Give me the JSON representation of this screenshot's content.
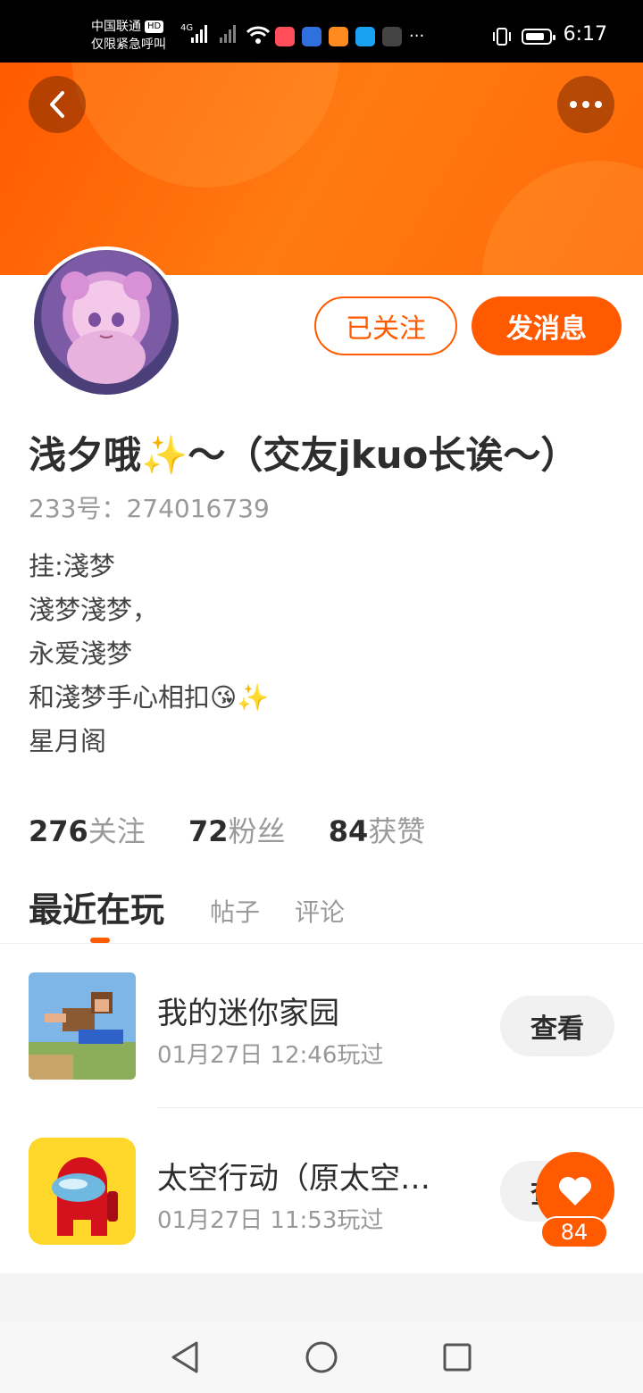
{
  "status": {
    "carrier": "中国联通",
    "carrier_badge": "HD",
    "carrier_sub": "仅限紧急呼叫",
    "network": "4G",
    "time": "6:17",
    "more": "···"
  },
  "header": {
    "back_icon": "chevron-left-icon",
    "more_icon": "more-horizontal-icon"
  },
  "profile": {
    "follow_label": "已关注",
    "message_label": "发消息",
    "name": "浅夕哦",
    "name_sparkle": "✨",
    "name_rest": "～（交友jkuo长诶～）",
    "id_label": "233号：",
    "id_value": "274016739",
    "bio": [
      "挂:淺梦",
      "淺梦淺梦，",
      "永爱淺梦",
      "和淺梦手心相扣",
      "星月阁"
    ],
    "bio_emoji_kiss": "😘",
    "bio_emoji_sparkle": "✨"
  },
  "stats": [
    {
      "num": "276",
      "label": "关注"
    },
    {
      "num": "72",
      "label": "粉丝"
    },
    {
      "num": "84",
      "label": "获赞"
    }
  ],
  "tabs": {
    "active": "最近在玩",
    "items": [
      "帖子",
      "评论"
    ]
  },
  "games": [
    {
      "title": "我的迷你家园",
      "time": "01月27日 12:46玩过",
      "action": "查看"
    },
    {
      "title": "太空行动（原太空…",
      "time": "01月27日 11:53玩过",
      "action": "查看"
    }
  ],
  "like": {
    "count": "84",
    "icon": "heart-icon"
  },
  "colors": {
    "accent": "#ff5a00",
    "text": "#2d2d2d",
    "muted": "#999999"
  }
}
